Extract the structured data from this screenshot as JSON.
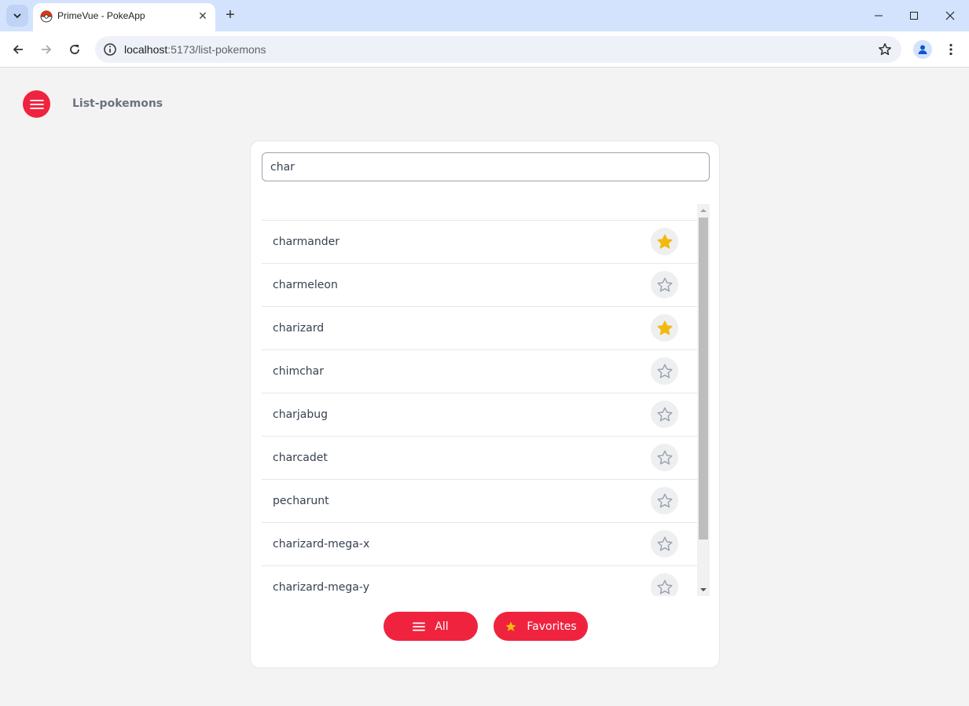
{
  "browser": {
    "tab_title": "PrimeVue - PokeApp",
    "url_host": "localhost",
    "url_path": ":5173/list-pokemons"
  },
  "header": {
    "title": "List-pokemons"
  },
  "search": {
    "value": "char"
  },
  "pokemons": [
    {
      "name": "charmander",
      "favorite": true
    },
    {
      "name": "charmeleon",
      "favorite": false
    },
    {
      "name": "charizard",
      "favorite": true
    },
    {
      "name": "chimchar",
      "favorite": false
    },
    {
      "name": "charjabug",
      "favorite": false
    },
    {
      "name": "charcadet",
      "favorite": false
    },
    {
      "name": "pecharunt",
      "favorite": false
    },
    {
      "name": "charizard-mega-x",
      "favorite": false
    },
    {
      "name": "charizard-mega-y",
      "favorite": false
    }
  ],
  "footer": {
    "all_label": "All",
    "favorites_label": "Favorites"
  },
  "colors": {
    "accent": "#f0233f",
    "star_filled": "#f2b90f",
    "star_outline": "#9ca3af"
  },
  "icons": {
    "menu": "hamburger-icon",
    "favorite": "star-icon"
  }
}
